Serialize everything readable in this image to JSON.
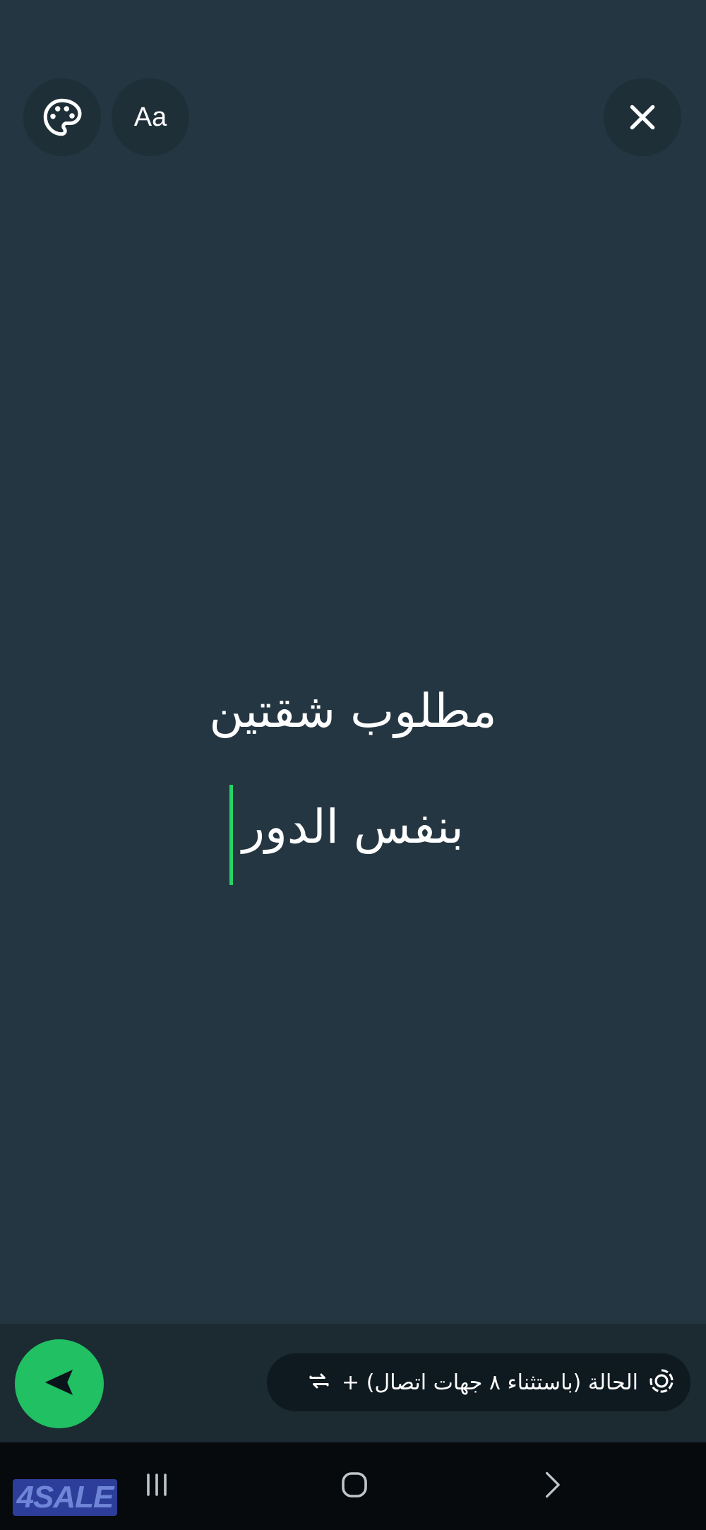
{
  "toolbar": {
    "palette_icon": "palette-icon",
    "font_button_label": "Aa",
    "close_icon": "close-icon"
  },
  "status": {
    "line1": "مطلوب شقتين",
    "line2": "بنفس الدور"
  },
  "audience": {
    "label": "الحالة (باستثناء ٨ جهات اتصال) +",
    "status_icon": "status-icon",
    "repeat_icon": "repeat-icon"
  },
  "send": {
    "icon": "send-icon"
  },
  "nav": {
    "recents_icon": "recents-icon",
    "home_icon": "home-icon",
    "back_icon": "back-icon"
  },
  "watermark": {
    "text": "4SALE"
  },
  "colors": {
    "background": "#243641",
    "accent": "#25d366",
    "send_button": "#21c063",
    "caret": "#25d366"
  }
}
